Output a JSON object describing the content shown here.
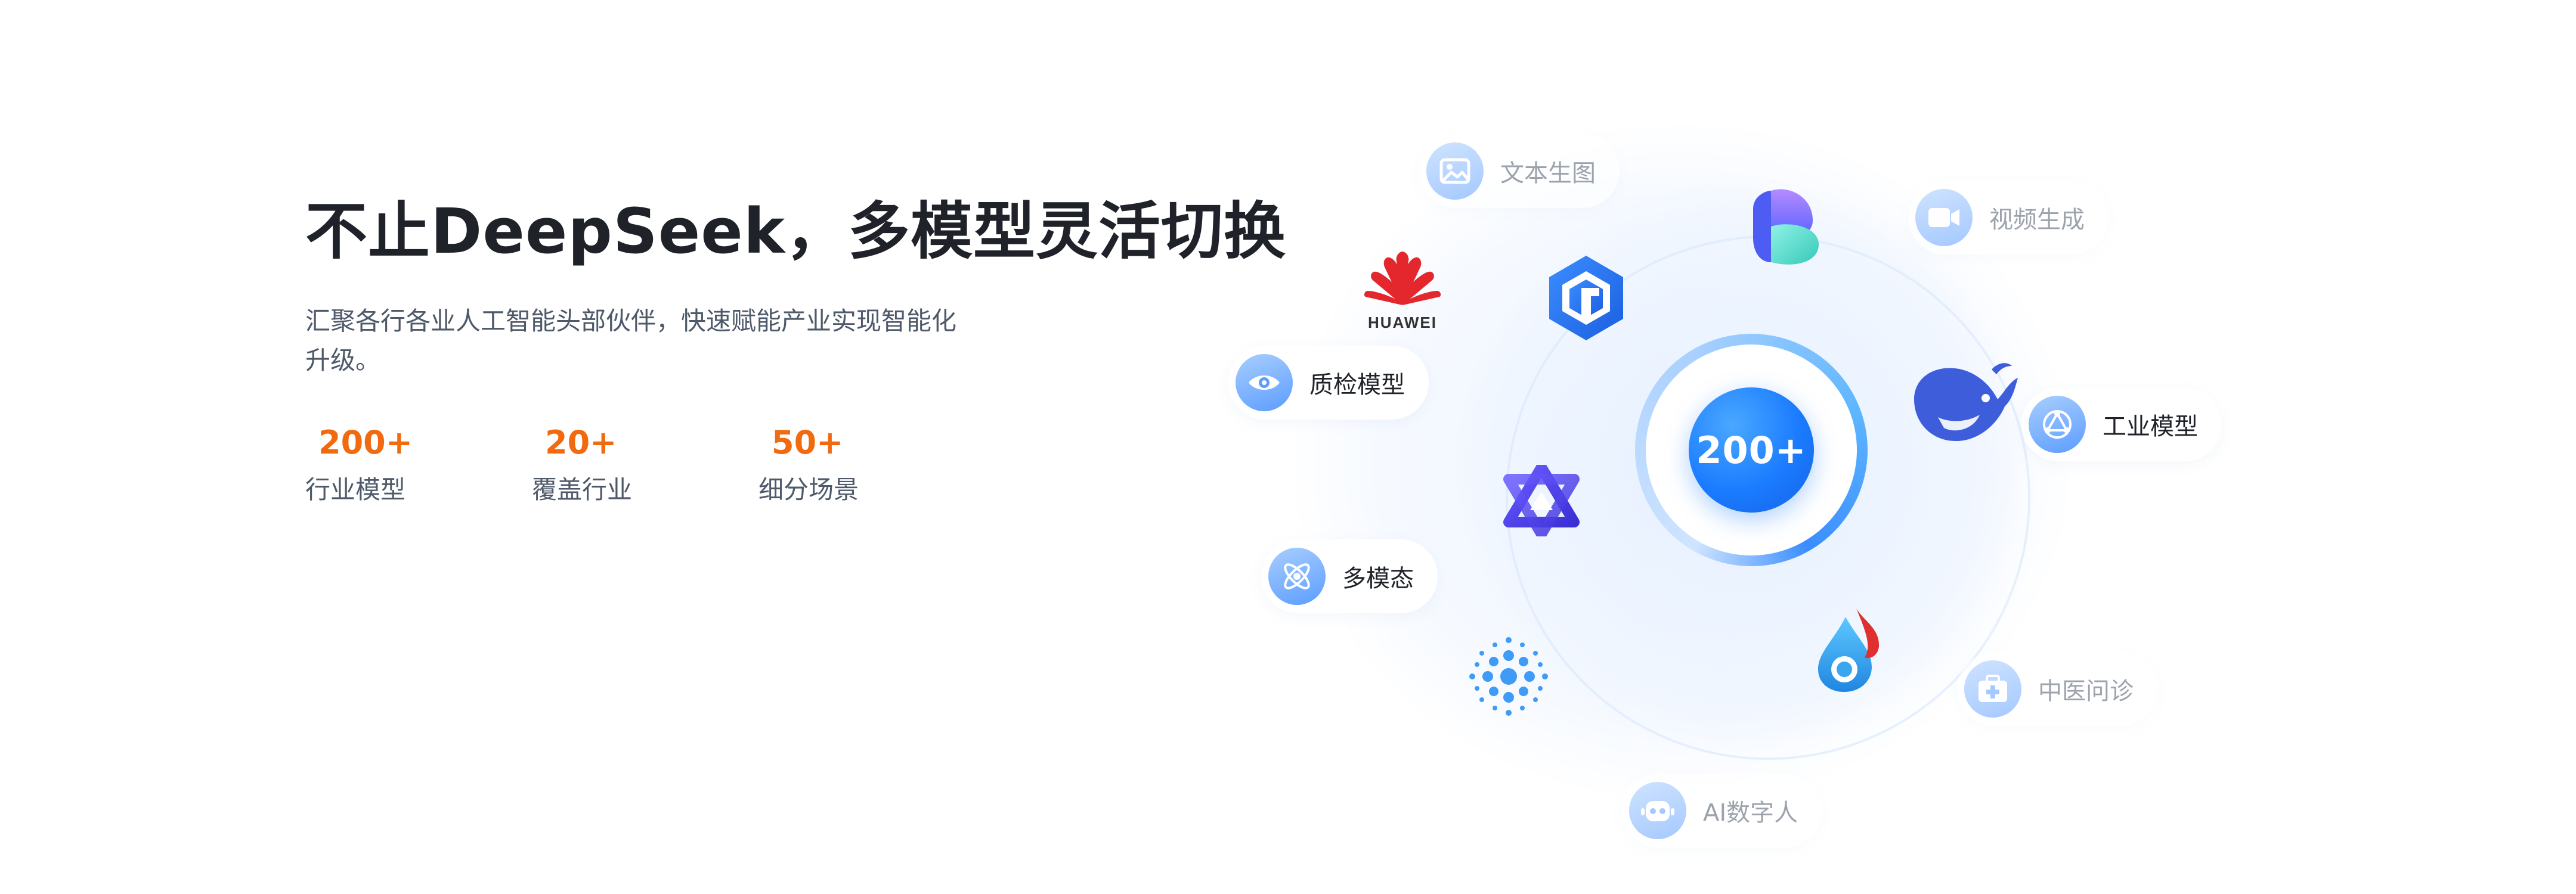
{
  "hero": {
    "title": "不止DeepSeek，多模型灵活切换",
    "subtitle": "汇聚各行各业人工智能头部伙伴，快速赋能产业实现智能化升级。"
  },
  "stats": [
    {
      "value": "200+",
      "label": "行业模型"
    },
    {
      "value": "20+",
      "label": "覆盖行业"
    },
    {
      "value": "50+",
      "label": "细分场景"
    }
  ],
  "diagram": {
    "center_value": "200+",
    "capabilities": [
      {
        "label": "文本生图",
        "icon": "image-icon",
        "faded": true
      },
      {
        "label": "视频生成",
        "icon": "video-camera-icon",
        "faded": true
      },
      {
        "label": "质检模型",
        "icon": "eye-icon",
        "faded": false
      },
      {
        "label": "工业模型",
        "icon": "network-icon",
        "faded": false
      },
      {
        "label": "多模态",
        "icon": "atom-icon",
        "faded": false
      },
      {
        "label": "中医问诊",
        "icon": "medical-kit-icon",
        "faded": true
      },
      {
        "label": "AI数字人",
        "icon": "robot-icon",
        "faded": true
      }
    ],
    "logos": {
      "huawei": "HUAWEI"
    }
  },
  "colors": {
    "headline": "#1f2329",
    "body_text": "#4e5969",
    "accent_orange": "#f26a0f",
    "accent_blue": "#1b7cff"
  }
}
